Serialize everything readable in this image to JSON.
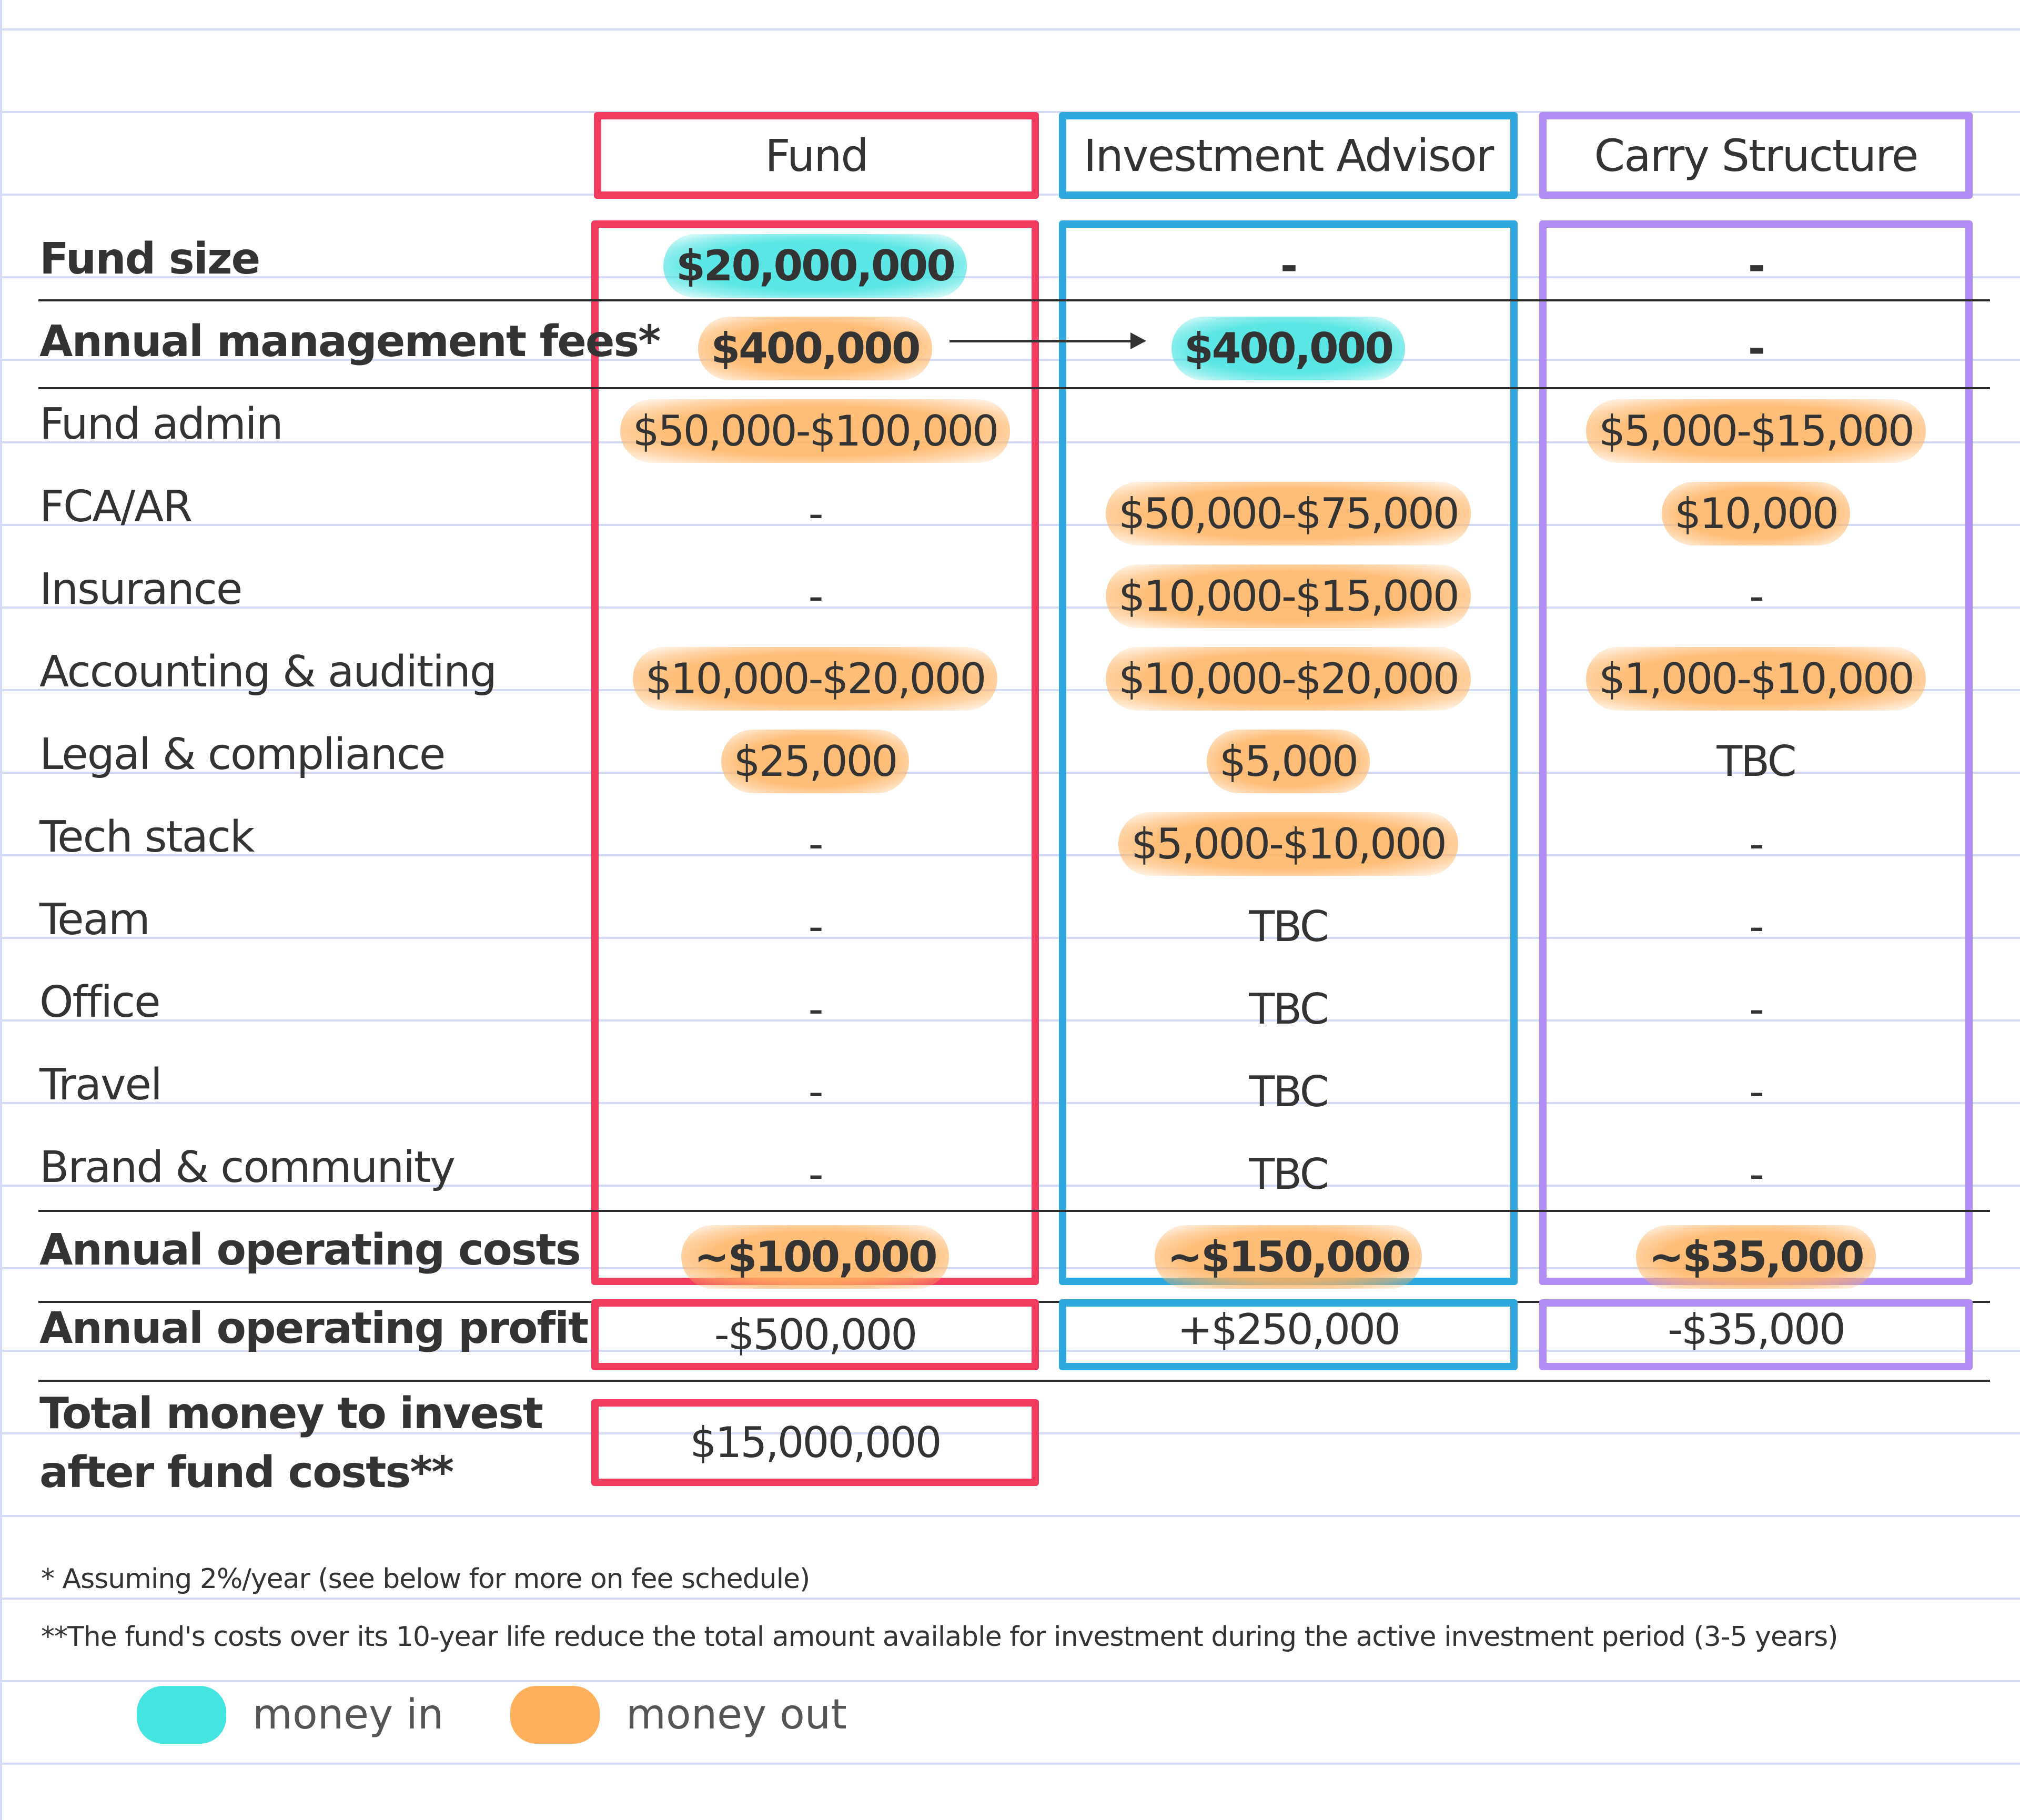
{
  "columns": [
    {
      "key": "fund",
      "label": "Fund",
      "color": "#f23c5f"
    },
    {
      "key": "ia",
      "label": "Investment Advisor",
      "color": "#2ea8de"
    },
    {
      "key": "carry",
      "label": "Carry Structure",
      "color": "#b18ef5"
    }
  ],
  "rows": [
    {
      "label": "Fund size",
      "bold": true,
      "fund": {
        "v": "$20,000,000",
        "hl": "in"
      },
      "ia": {
        "v": "-",
        "hl": ""
      },
      "carry": {
        "v": "-",
        "hl": ""
      }
    },
    {
      "label": "Annual management fees*",
      "bold": true,
      "fund": {
        "v": "$400,000",
        "hl": "out"
      },
      "ia": {
        "v": "$400,000",
        "hl": "in"
      },
      "carry": {
        "v": "-",
        "hl": ""
      }
    },
    {
      "label": "Fund admin",
      "bold": false,
      "fund": {
        "v": "$50,000-$100,000",
        "hl": "out"
      },
      "ia": {
        "v": "",
        "hl": ""
      },
      "carry": {
        "v": "$5,000-$15,000",
        "hl": "out"
      }
    },
    {
      "label": "FCA/AR",
      "bold": false,
      "fund": {
        "v": "-",
        "hl": ""
      },
      "ia": {
        "v": "$50,000-$75,000",
        "hl": "out"
      },
      "carry": {
        "v": "$10,000",
        "hl": "out"
      }
    },
    {
      "label": "Insurance",
      "bold": false,
      "fund": {
        "v": "-",
        "hl": ""
      },
      "ia": {
        "v": "$10,000-$15,000",
        "hl": "out"
      },
      "carry": {
        "v": "-",
        "hl": ""
      }
    },
    {
      "label": "Accounting & auditing",
      "bold": false,
      "fund": {
        "v": "$10,000-$20,000",
        "hl": "out"
      },
      "ia": {
        "v": "$10,000-$20,000",
        "hl": "out"
      },
      "carry": {
        "v": "$1,000-$10,000",
        "hl": "out"
      }
    },
    {
      "label": "Legal & compliance",
      "bold": false,
      "fund": {
        "v": "$25,000",
        "hl": "out"
      },
      "ia": {
        "v": "$5,000",
        "hl": "out"
      },
      "carry": {
        "v": "TBC",
        "hl": ""
      }
    },
    {
      "label": "Tech stack",
      "bold": false,
      "fund": {
        "v": "-",
        "hl": ""
      },
      "ia": {
        "v": "$5,000-$10,000",
        "hl": "out"
      },
      "carry": {
        "v": "-",
        "hl": ""
      }
    },
    {
      "label": "Team",
      "bold": false,
      "fund": {
        "v": "-",
        "hl": ""
      },
      "ia": {
        "v": "TBC",
        "hl": ""
      },
      "carry": {
        "v": "-",
        "hl": ""
      }
    },
    {
      "label": "Office",
      "bold": false,
      "fund": {
        "v": "-",
        "hl": ""
      },
      "ia": {
        "v": "TBC",
        "hl": ""
      },
      "carry": {
        "v": "-",
        "hl": ""
      }
    },
    {
      "label": "Travel",
      "bold": false,
      "fund": {
        "v": "-",
        "hl": ""
      },
      "ia": {
        "v": "TBC",
        "hl": ""
      },
      "carry": {
        "v": "-",
        "hl": ""
      }
    },
    {
      "label": "Brand & community",
      "bold": false,
      "fund": {
        "v": "-",
        "hl": ""
      },
      "ia": {
        "v": "TBC",
        "hl": ""
      },
      "carry": {
        "v": "-",
        "hl": ""
      }
    },
    {
      "label": "Annual operating costs",
      "bold": true,
      "fund": {
        "v": "~$100,000",
        "hl": "out"
      },
      "ia": {
        "v": "~$150,000",
        "hl": "out"
      },
      "carry": {
        "v": "~$35,000",
        "hl": "out"
      }
    }
  ],
  "profit": {
    "label": "Annual operating profit",
    "fund": "-$500,000",
    "ia": "+$250,000",
    "carry": "-$35,000"
  },
  "total": {
    "label_line1": "Total money to invest",
    "label_line2": "after fund costs**",
    "fund": "$15,000,000"
  },
  "footnotes": [
    "* Assuming 2%/year (see below for more on fee schedule)",
    "**The fund's costs over its 10-year life reduce the total amount available for investment during the active investment period (3-5 years)"
  ],
  "legend": [
    {
      "label": "money in",
      "kind": "in",
      "color": "#44e4e0"
    },
    {
      "label": "money out",
      "kind": "out",
      "color": "#ffb05c"
    }
  ],
  "arrow": {
    "from": "fund.management_fees",
    "to": "investment_advisor.management_fees"
  }
}
